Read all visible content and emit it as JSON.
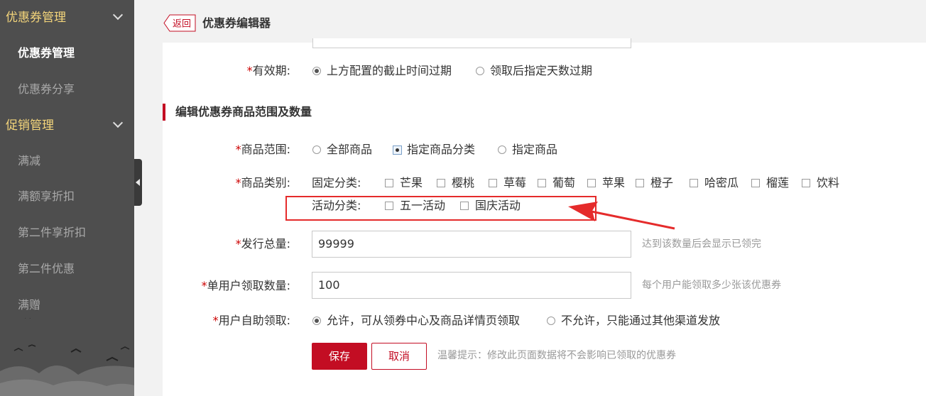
{
  "sidebar": {
    "groups": [
      {
        "label": "优惠券管理",
        "items": [
          "优惠券管理",
          "优惠券分享"
        ]
      },
      {
        "label": "促销管理",
        "items": [
          "满减",
          "满额享折扣",
          "第二件享折扣",
          "第二件优惠",
          "满赠"
        ]
      }
    ]
  },
  "header": {
    "back_label": "返回",
    "title": "优惠券编辑器"
  },
  "form": {
    "validity": {
      "label": "有效期:",
      "options": [
        "上方配置的截止时间过期",
        "领取后指定天数过期"
      ],
      "selected": 0
    },
    "section_title": "编辑优惠券商品范围及数量",
    "scope": {
      "label": "商品范围:",
      "options": [
        "全部商品",
        "指定商品分类",
        "指定商品"
      ],
      "selected": 1
    },
    "category": {
      "label": "商品类别:",
      "fixed_label": "固定分类:",
      "fixed_items": [
        "芒果",
        "樱桃",
        "草莓",
        "葡萄",
        "苹果",
        "橙子",
        "哈密瓜",
        "榴莲",
        "饮料"
      ],
      "activity_label": "活动分类:",
      "activity_items": [
        "五一活动",
        "国庆活动"
      ]
    },
    "total": {
      "label": "发行总量:",
      "value": "99999",
      "hint": "达到该数量后会显示已领完"
    },
    "per_user": {
      "label": "单用户领取数量:",
      "value": "100",
      "hint": "每个用户能领取多少张该优惠券"
    },
    "self_claim": {
      "label": "用户自助领取:",
      "options": [
        "允许，可从领券中心及商品详情页领取",
        "不允许，只能通过其他渠道发放"
      ],
      "selected": 0
    },
    "save_label": "保存",
    "cancel_label": "取消",
    "tip": "温馨提示：修改此页面数据将不会影响已领取的优惠券"
  },
  "colors": {
    "accent": "#c30d23",
    "sidebar_bg": "#4e4e4e",
    "group_text": "#f4d57b",
    "annotation": "#e52b2b"
  },
  "icons": [
    "chevron-down-icon",
    "collapse-arrow-icon",
    "radio-icon",
    "checkbox-icon",
    "annotation-arrow-icon"
  ]
}
